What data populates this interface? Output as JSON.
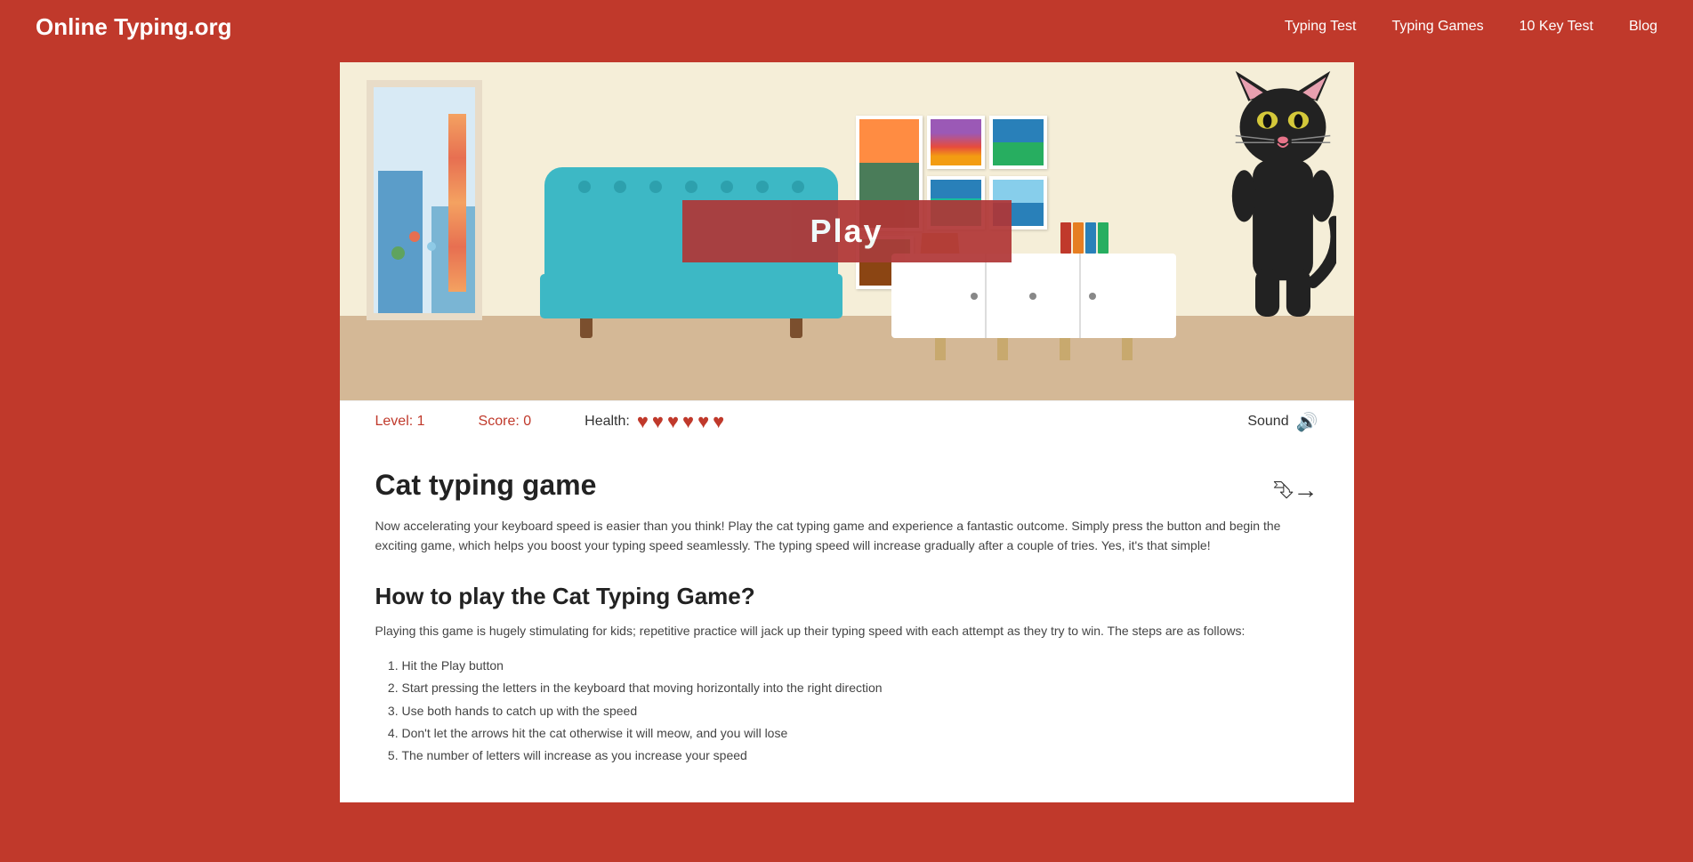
{
  "header": {
    "logo": "Online Typing.org",
    "nav": [
      {
        "label": "Typing Test",
        "href": "#"
      },
      {
        "label": "Typing Games",
        "href": "#"
      },
      {
        "label": "10 Key Test",
        "href": "#"
      },
      {
        "label": "Blog",
        "href": "#"
      }
    ]
  },
  "game": {
    "play_button_label": "Play",
    "status": {
      "level_label": "Level: 1",
      "score_label": "Score: 0",
      "health_label": "Health:",
      "heart_count": 6,
      "sound_label": "Sound"
    }
  },
  "content": {
    "game_title": "Cat typing game",
    "description": "Now accelerating your keyboard speed is easier than you think! Play the cat typing game and experience a fantastic outcome. Simply press the button and begin the exciting game, which helps you boost your typing speed seamlessly. The typing speed will increase gradually after a couple of tries. Yes, it's that simple!",
    "how_to_title": "How to play the Cat Typing Game?",
    "how_to_intro": "Playing this game is hugely stimulating for kids; repetitive practice will jack up their typing speed with each attempt as they try to win. The steps are as follows:",
    "steps": [
      "Hit the Play button",
      "Start pressing the letters in the keyboard that moving horizontally into the right direction",
      "Use both hands to catch up with the speed",
      "Don't let the arrows hit the cat otherwise it will meow, and you will lose",
      "The number of letters will increase as you increase your speed"
    ]
  }
}
